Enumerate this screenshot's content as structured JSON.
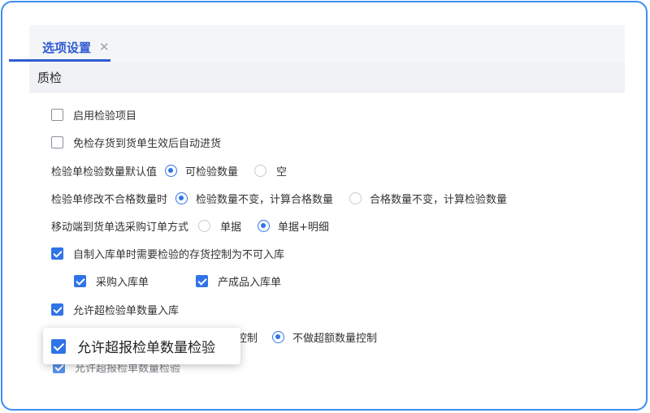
{
  "tab": {
    "label": "选项设置",
    "close_glyph": "✕"
  },
  "section": {
    "title": "质检"
  },
  "options": {
    "enable_inspection": {
      "label": "启用检验项目",
      "checked": false
    },
    "auto_receive": {
      "label": "免检存货到货单生效后自动进货",
      "checked": false
    },
    "default_qty": {
      "label": "检验单检验数量默认值",
      "choices": [
        "可检验数量",
        "空"
      ],
      "selected": "可检验数量"
    },
    "modify_fail_qty": {
      "label": "检验单修改不合格数量时",
      "choices": [
        "检验数量不变，计算合格数量",
        "合格数量不变，计算检验数量"
      ],
      "selected": "检验数量不变，计算合格数量"
    },
    "mobile_method": {
      "label": "移动端到货单选采购订单方式",
      "choices": [
        "单据",
        "单据+明细"
      ],
      "selected": "单据+明细"
    },
    "self_made_control": {
      "label": "自制入库单时需要检验的存货控制为不可入库",
      "checked": true
    },
    "purchase_receipt": {
      "label": "采购入库单",
      "checked": true
    },
    "product_receipt": {
      "label": "产成品入库单",
      "checked": true
    },
    "allow_over_receipt": {
      "label": "允许超检验单数量入库",
      "checked": true
    },
    "over_control": {
      "partial_label": "控制",
      "no_control_label": "不做超额数量控制",
      "selected": "不做超额数量控制"
    }
  },
  "popup": {
    "label": "允许超报检单数量检验",
    "checked": true
  },
  "ghost": {
    "label": "允许超报检单数量检验"
  },
  "colors": {
    "accent": "#2f74e8",
    "tab_text": "#2f5bd3",
    "frame": "#3d8ef0"
  }
}
